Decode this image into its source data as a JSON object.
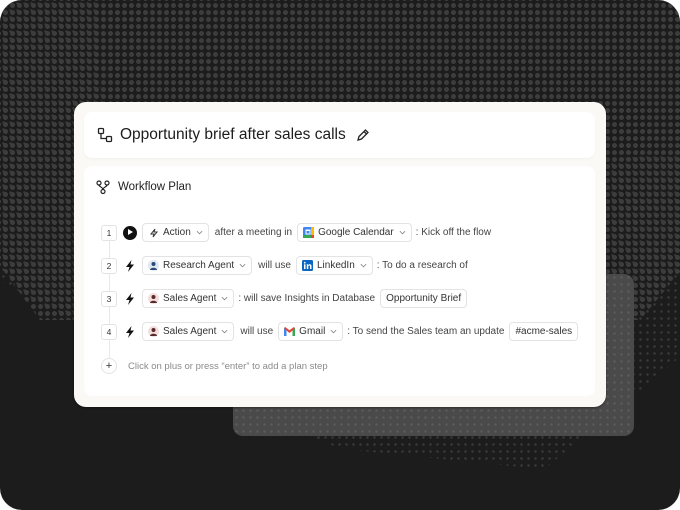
{
  "header": {
    "title": "Opportunity brief after sales calls",
    "title_icon": "workflow-nodes-icon",
    "edit_icon": "pencil-icon"
  },
  "plan": {
    "title": "Workflow Plan",
    "icon": "workflow-branch-icon",
    "steps": [
      {
        "number": "1",
        "trigger_icon": "play-icon",
        "actor": {
          "label": "Action",
          "icon": "lightning-outline-icon"
        },
        "connector": "after a meeting in",
        "tool": {
          "label": "Google Calendar",
          "icon": "google-calendar-icon"
        },
        "description": ": Kick off the flow"
      },
      {
        "number": "2",
        "trigger_icon": "lightning-icon",
        "actor": {
          "label": "Research Agent",
          "icon": "research-agent-avatar"
        },
        "connector": "will use",
        "tool": {
          "label": "LinkedIn",
          "icon": "linkedin-icon"
        },
        "description": ": To do a research of"
      },
      {
        "number": "3",
        "trigger_icon": "lightning-icon",
        "actor": {
          "label": "Sales Agent",
          "icon": "sales-agent-avatar"
        },
        "connector": ": will save Insights in Database",
        "tag": "Opportunity Brief"
      },
      {
        "number": "4",
        "trigger_icon": "lightning-icon",
        "actor": {
          "label": "Sales Agent",
          "icon": "sales-agent-avatar"
        },
        "connector": "will use",
        "tool": {
          "label": "Gmail",
          "icon": "gmail-icon"
        },
        "description": ": To send the Sales team an update",
        "tag": "#acme-sales"
      }
    ],
    "add_step_hint": "Click on plus or press “enter” to add a plan step"
  },
  "colors": {
    "background": "#1c1c1c",
    "card": "#faf9f5",
    "panel": "#ffffff",
    "linkedin": "#0a66c2",
    "gmail_red": "#ea4335"
  }
}
